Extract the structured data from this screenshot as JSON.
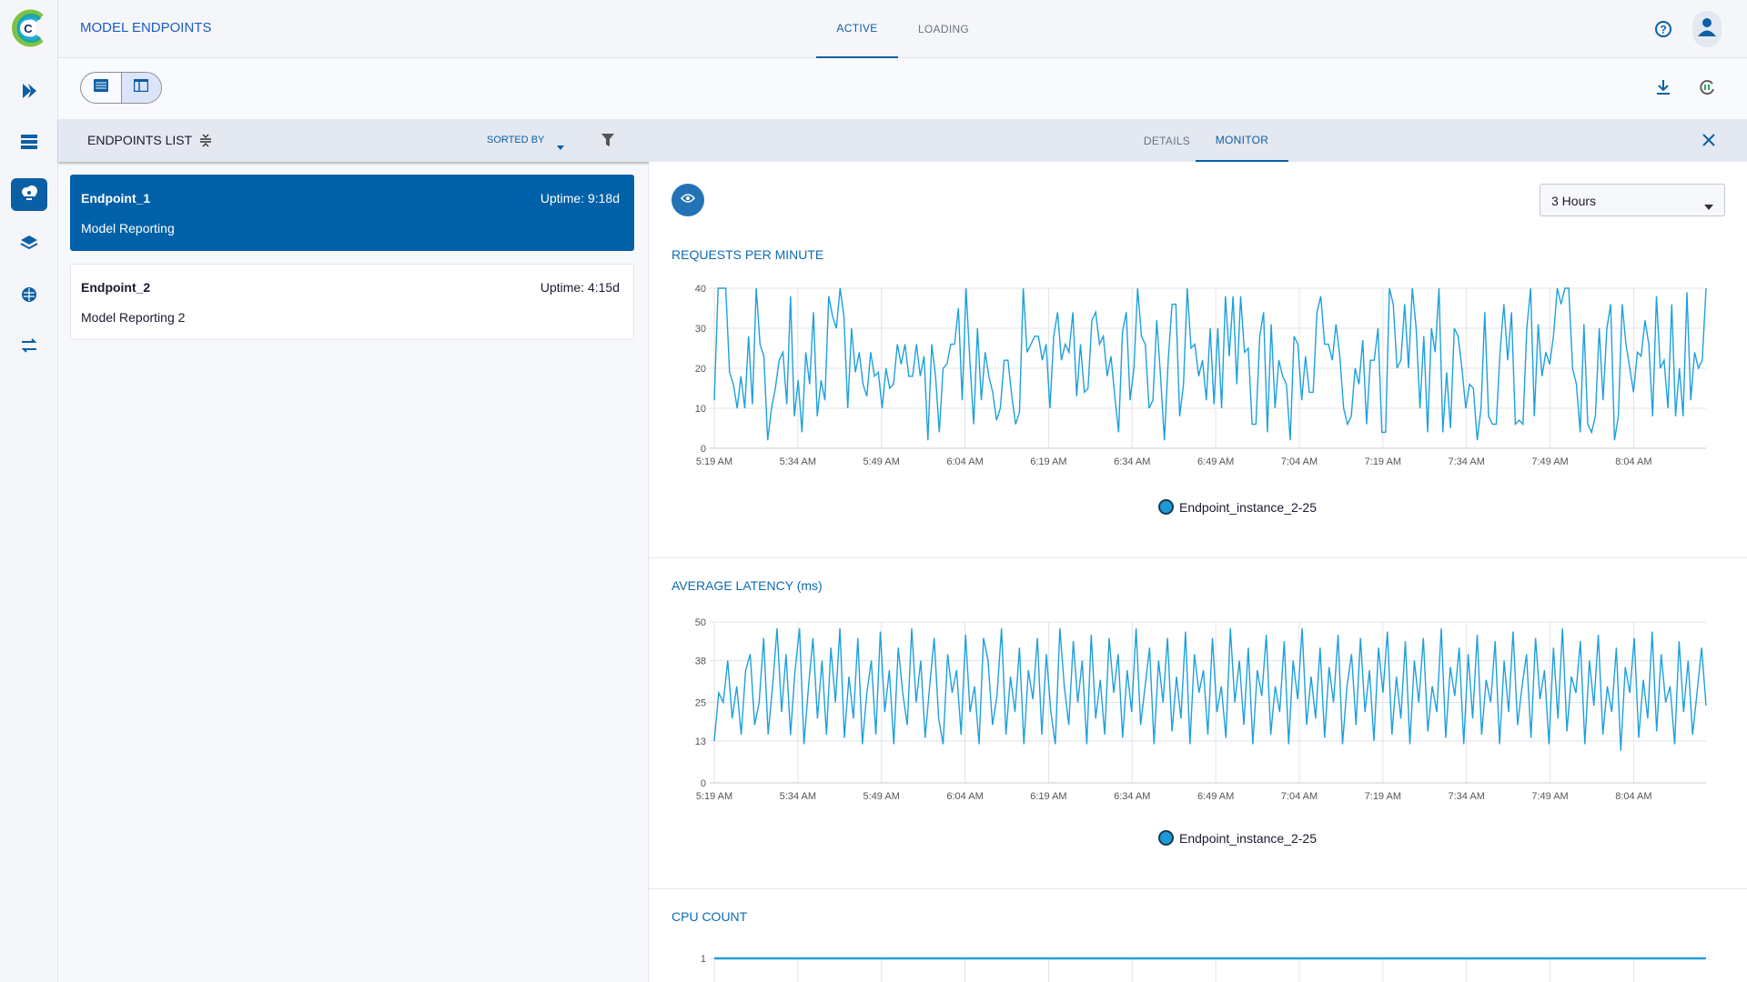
{
  "colors": {
    "accent": "#0b5fa5",
    "line": "#1ea0dc",
    "selected_card": "#0061a8"
  },
  "sidebar": {
    "logo": "C",
    "items": [
      {
        "icon": "chevrons-right-icon"
      },
      {
        "icon": "datasets-icon"
      },
      {
        "icon": "cloud-model-icon",
        "active": true
      },
      {
        "icon": "layers-icon"
      },
      {
        "icon": "brain-icon"
      },
      {
        "icon": "pipelines-icon"
      }
    ]
  },
  "header": {
    "title": "MODEL ENDPOINTS",
    "tabs": [
      {
        "label": "ACTIVE",
        "active": true
      },
      {
        "label": "LOADING",
        "active": false
      }
    ]
  },
  "list": {
    "title": "ENDPOINTS LIST",
    "sorted_by": "SORTED BY",
    "endpoints": [
      {
        "name": "Endpoint_1",
        "uptime": "Uptime: 9:18d",
        "description": "Model Reporting",
        "selected": true
      },
      {
        "name": "Endpoint_2",
        "uptime": "Uptime: 4:15d",
        "description": "Model Reporting 2",
        "selected": false
      }
    ]
  },
  "details": {
    "tabs": [
      {
        "label": "DETAILS",
        "active": false
      },
      {
        "label": "MONITOR",
        "active": true
      }
    ],
    "time_range": "3 Hours"
  },
  "chart_data": [
    {
      "type": "line",
      "title": "REQUESTS PER MINUTE",
      "x_ticks": [
        "5:19 AM",
        "5:34 AM",
        "5:49 AM",
        "6:04 AM",
        "6:19 AM",
        "6:34 AM",
        "6:49 AM",
        "7:04 AM",
        "7:19 AM",
        "7:34 AM",
        "7:49 AM",
        "8:04 AM"
      ],
      "y_ticks": [
        0,
        10,
        20,
        30,
        40
      ],
      "ylim": [
        0,
        40
      ],
      "grid": true,
      "legend": "bottom",
      "series": [
        {
          "name": "Endpoint_instance_2-25",
          "values": [
            12,
            40,
            40,
            40,
            19,
            16,
            10,
            18,
            10,
            28,
            11,
            40,
            26,
            23,
            2,
            10,
            15,
            22,
            24,
            11,
            38,
            8,
            17,
            4,
            24,
            16,
            34,
            8,
            17,
            12,
            38,
            33,
            30,
            40,
            33,
            10,
            30,
            19,
            24,
            16,
            13,
            24,
            18,
            19,
            10,
            20,
            15,
            16,
            26,
            21,
            26,
            18,
            18,
            26,
            18,
            23,
            2,
            26,
            18,
            4,
            20,
            21,
            26,
            26,
            35,
            12,
            40,
            22,
            6,
            30,
            12,
            24,
            18,
            14,
            7,
            10,
            22,
            22,
            13,
            6,
            9,
            40,
            24,
            26,
            28,
            28,
            22,
            26,
            10,
            28,
            34,
            22,
            26,
            24,
            34,
            13,
            26,
            14,
            15,
            32,
            34,
            26,
            28,
            18,
            23,
            13,
            4,
            29,
            34,
            12,
            20,
            40,
            28,
            26,
            10,
            12,
            32,
            18,
            2,
            22,
            36,
            36,
            8,
            16,
            40,
            25,
            26,
            18,
            22,
            12,
            30,
            11,
            30,
            10,
            38,
            23,
            38,
            16,
            38,
            24,
            25,
            6,
            6,
            28,
            34,
            4,
            31,
            10,
            22,
            18,
            16,
            2,
            28,
            26,
            12,
            23,
            14,
            14,
            34,
            38,
            26,
            26,
            22,
            31,
            23,
            10,
            6,
            8,
            20,
            16,
            27,
            6,
            22,
            22,
            30,
            4,
            4,
            40,
            36,
            20,
            22,
            36,
            20,
            40,
            30,
            10,
            28,
            4,
            30,
            24,
            40,
            4,
            19,
            5,
            30,
            28,
            20,
            10,
            16,
            15,
            2,
            10,
            34,
            8,
            6,
            6,
            24,
            36,
            22,
            34,
            6,
            7,
            6,
            30,
            40,
            8,
            31,
            18,
            24,
            21,
            28,
            40,
            36,
            40,
            40,
            20,
            16,
            4,
            31,
            6,
            4,
            8,
            30,
            12,
            30,
            36,
            2,
            8,
            36,
            26,
            20,
            14,
            24,
            23,
            32,
            26,
            8,
            38,
            20,
            22,
            10,
            36,
            8,
            20,
            8,
            39,
            12,
            24,
            20,
            22,
            40
          ]
        }
      ]
    },
    {
      "type": "line",
      "title": "AVERAGE LATENCY (ms)",
      "x_ticks": [
        "5:19 AM",
        "5:34 AM",
        "5:49 AM",
        "6:04 AM",
        "6:19 AM",
        "6:34 AM",
        "6:49 AM",
        "7:04 AM",
        "7:19 AM",
        "7:34 AM",
        "7:49 AM",
        "8:04 AM"
      ],
      "y_ticks": [
        0,
        13,
        25,
        38,
        50
      ],
      "ylim": [
        0,
        50
      ],
      "grid": true,
      "legend": "bottom",
      "series": [
        {
          "name": "Endpoint_instance_2-25",
          "values": [
            13,
            28,
            25,
            38,
            20,
            30,
            15,
            35,
            40,
            18,
            25,
            45,
            15,
            30,
            48,
            22,
            40,
            15,
            35,
            48,
            12,
            30,
            45,
            20,
            38,
            15,
            42,
            25,
            48,
            14,
            33,
            20,
            45,
            12,
            28,
            38,
            15,
            47,
            22,
            35,
            12,
            42,
            28,
            18,
            48,
            25,
            38,
            14,
            30,
            45,
            20,
            12,
            40,
            28,
            35,
            15,
            46,
            22,
            30,
            12,
            45,
            38,
            18,
            27,
            48,
            15,
            33,
            22,
            42,
            12,
            35,
            26,
            45,
            15,
            40,
            22,
            12,
            48,
            30,
            18,
            44,
            25,
            38,
            12,
            46,
            20,
            32,
            15,
            45,
            28,
            40,
            14,
            35,
            22,
            48,
            18,
            30,
            42,
            12,
            38,
            25,
            45,
            16,
            33,
            20,
            47,
            12,
            40,
            28,
            35,
            15,
            45,
            22,
            30,
            14,
            48,
            25,
            38,
            18,
            42,
            12,
            35,
            27,
            46,
            15,
            30,
            22,
            44,
            12,
            38,
            26,
            48,
            18,
            33,
            20,
            42,
            14,
            36,
            25,
            46,
            12,
            30,
            40,
            18,
            45,
            22,
            35,
            13,
            42,
            28,
            47,
            15,
            33,
            20,
            44,
            12,
            38,
            25,
            45,
            16,
            30,
            22,
            48,
            14,
            36,
            27,
            42,
            12,
            40,
            20,
            46,
            15,
            32,
            25,
            44,
            12,
            38,
            22,
            47,
            18,
            30,
            40,
            14,
            45,
            26,
            35,
            12,
            42,
            20,
            48,
            16,
            33,
            28,
            44,
            12,
            38,
            24,
            46,
            15,
            30,
            22,
            42,
            10,
            36,
            28,
            45,
            14,
            32,
            20,
            47,
            16,
            40,
            25,
            30,
            12,
            44,
            22,
            38,
            15,
            28,
            42,
            24
          ]
        }
      ]
    },
    {
      "type": "line",
      "title": "CPU COUNT",
      "y_ticks": [
        1
      ],
      "grid": true,
      "series": [
        {
          "values": [
            1,
            1
          ]
        }
      ]
    }
  ]
}
